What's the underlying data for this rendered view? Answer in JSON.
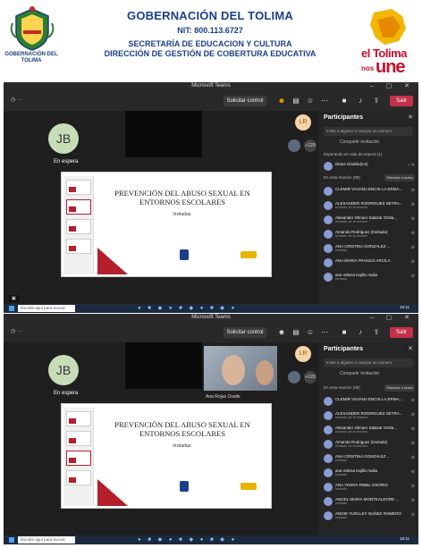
{
  "header": {
    "crest_caption": "GOBERNACIÓN DEL TOLIMA",
    "title": "GOBERNACIÓN DEL TOLIMA",
    "nit": "NIT: 800.113.6727",
    "secretaria": "SECRETARÍA DE EDUCACION Y CULTURA",
    "direccion": "DIRECCIÓN DE GESTIÓN DE COBERTURA EDUCATIVA",
    "brand_line1": "el Tolima",
    "brand_line2": "nos",
    "brand_line3": "une"
  },
  "windows": [
    {
      "title": "Microsoft Teams",
      "view_button": "Solicitar control",
      "leave_button": "Salir",
      "avatar_initials": "JB",
      "avatar_status": "En espera",
      "lr_initials": "LR",
      "more_count": "+120",
      "slide": {
        "title": "PREVENCIÓN DEL ABUSO SEXUAL EN ENTORNOS ESCOLARES",
        "invited": "Invitadas:"
      },
      "panel": {
        "title": "Participantes",
        "search_placeholder": "Invite a alguien o marque un número",
        "share_invite": "Compartir invitación",
        "lobby": "Esperando en sala de espera (1)",
        "meeting": "En esta reunión (99)",
        "mute_all": "Silenciar a todos",
        "people": [
          {
            "name": "Diana Giraldo(Inv)",
            "sub": ""
          },
          {
            "name": "CLEMIR VIVIANA ENCIS LA ERMA...",
            "sub": ""
          },
          {
            "name": "ALEXANDER RODRIGUEZ SETRA...",
            "sub": "Invitado de la reunión"
          },
          {
            "name": "Alexander Olmaro Salazar Orrita...",
            "sub": "Invitado de la reunión"
          },
          {
            "name": "Amanda Rodriguez (Invitado)",
            "sub": "Invitado de la reunión"
          },
          {
            "name": "ANA CRISTINA GONZALEZ ...",
            "sub": "Invitado"
          },
          {
            "name": "ANA MARIA FRANCO ARCILA",
            "sub": ""
          },
          {
            "name": "ana milena trujillo mulia",
            "sub": "Invitado"
          }
        ]
      },
      "taskbar": {
        "search": "Escribe aquí para buscar",
        "time": "10:11"
      }
    },
    {
      "title": "Microsoft Teams",
      "view_button": "Solicitar control",
      "leave_button": "Salir",
      "avatar_initials": "JB",
      "avatar_status": "En espera",
      "lr_initials": "LR",
      "more_count": "+120",
      "camera_label": "Ana Rojas Ovalle",
      "slide": {
        "title": "PREVENCIÓN DEL ABUSO SEXUAL EN ENTORNOS ESCOLARES",
        "invited": "Invitadas:"
      },
      "panel": {
        "title": "Participantes",
        "search_placeholder": "Invite a alguien o marque un número",
        "share_invite": "Compartir invitación",
        "lobby": "",
        "meeting": "En esta reunión (99)",
        "mute_all": "Silenciar a todos",
        "people": [
          {
            "name": "CLEMIR VIVIANA ENCIS LA ERMA...",
            "sub": ""
          },
          {
            "name": "ALEXANDER RODRIGUEZ SETRA...",
            "sub": "Invitado de la reunión"
          },
          {
            "name": "Alexander Olmaro Salazar Orrita...",
            "sub": "Invitado de la reunión"
          },
          {
            "name": "Amanda Rodriguez (Invitado)",
            "sub": "Invitado de la reunión"
          },
          {
            "name": "ANA CRISTINA GONZALEZ ...",
            "sub": "Invitado"
          },
          {
            "name": "ana milena trujillo mulia",
            "sub": "Invitado"
          },
          {
            "name": "ANA YENNY RIBEL OSORIO",
            "sub": "Invitado"
          },
          {
            "name": "ANGEL MARIA MONTEALEGRE ...",
            "sub": "Invitado"
          },
          {
            "name": "ANGIE YURLLEY NUÑEZ ROMERO",
            "sub": "Invitado"
          }
        ]
      },
      "taskbar": {
        "search": "Escribe aquí para buscar",
        "time": "10:11"
      }
    }
  ],
  "colors": {
    "brand_red": "#c8102e",
    "header_blue": "#1b3f8c",
    "teams_bg": "#1f1f1f",
    "leave_red": "#c4314b"
  }
}
